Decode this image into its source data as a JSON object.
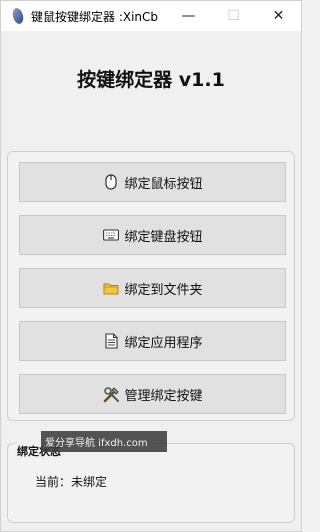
{
  "window": {
    "title": "键鼠按键绑定器 :XinCb",
    "controls": {
      "minimize": "—",
      "maximize": "☐",
      "close": "✕"
    }
  },
  "app_title": "按键绑定器 v1.1",
  "buttons": [
    {
      "label": "绑定鼠标按钮",
      "icon": "mouse-icon"
    },
    {
      "label": "绑定键盘按钮",
      "icon": "keyboard-icon"
    },
    {
      "label": "绑定到文件夹",
      "icon": "folder-icon"
    },
    {
      "label": "绑定应用程序",
      "icon": "document-icon"
    },
    {
      "label": "管理绑定按键",
      "icon": "tools-icon"
    }
  ],
  "status": {
    "group_label": "绑定状态",
    "current": "当前：未绑定"
  },
  "watermark": "爱分享导航 ifxdh.com",
  "colors": {
    "window_bg": "#f0f0f0",
    "button_bg": "#e1e1e1",
    "button_border": "#c7c7c7",
    "folder_yellow": "#f4c542"
  }
}
